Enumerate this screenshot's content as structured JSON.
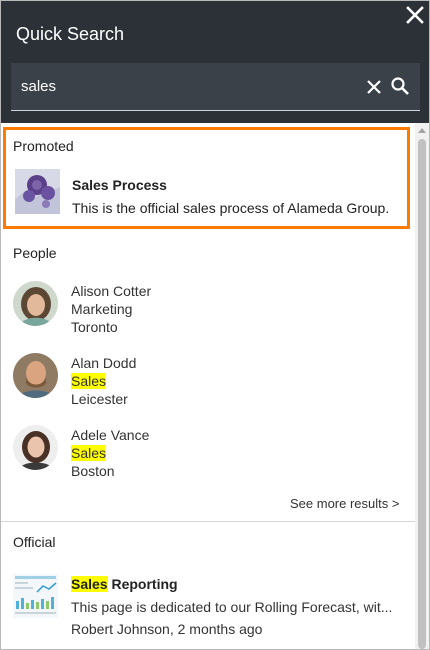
{
  "header": {
    "title": "Quick Search",
    "close_icon": "close-icon"
  },
  "search": {
    "value": "sales",
    "clear_icon": "clear-x-icon",
    "search_icon": "magnifier-icon"
  },
  "promoted": {
    "label": "Promoted",
    "title": "Sales Process",
    "description": "This is the official sales process of Alameda Group.",
    "border_color": "#ff7b00"
  },
  "people": {
    "label": "People",
    "items": [
      {
        "name": "Alison Cotter",
        "department": "Marketing",
        "location": "Toronto",
        "department_highlighted": false
      },
      {
        "name": "Alan Dodd",
        "department": "Sales",
        "location": "Leicester",
        "department_highlighted": true
      },
      {
        "name": "Adele Vance",
        "department": "Sales",
        "location": "Boston",
        "department_highlighted": true
      }
    ],
    "see_more": "See more results >"
  },
  "official": {
    "label": "Official",
    "title_highlight": "Sales",
    "title_rest": " Reporting",
    "description": "This page is dedicated to our Rolling Forecast, wit...",
    "meta": "Robert Johnson, 2 months ago"
  },
  "colors": {
    "header_bg": "#2b3137",
    "search_bg": "#3a4149",
    "highlight": "#ffff00",
    "accent": "#ff7b00"
  }
}
